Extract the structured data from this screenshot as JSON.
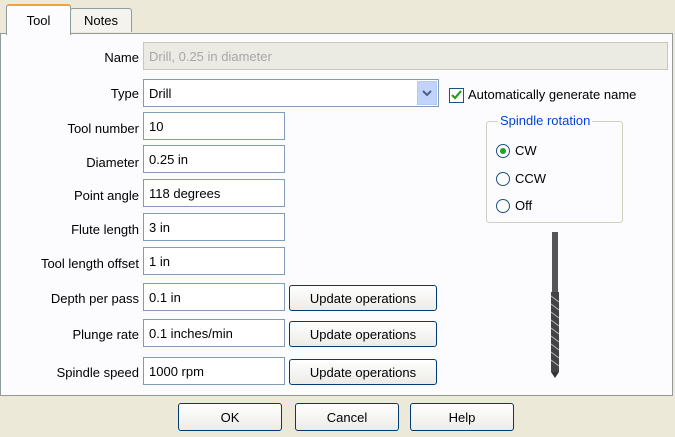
{
  "tabs": [
    {
      "label": "Tool"
    },
    {
      "label": "Notes"
    }
  ],
  "form": {
    "name": {
      "label": "Name",
      "value": "Drill, 0.25 in diameter"
    },
    "type": {
      "label": "Type",
      "value": "Drill"
    },
    "auto_name": {
      "label": "Automatically generate name",
      "checked": true
    },
    "tool_number": {
      "label": "Tool number",
      "value": "10"
    },
    "diameter": {
      "label": "Diameter",
      "value": "0.25 in"
    },
    "point_angle": {
      "label": "Point angle",
      "value": "118 degrees"
    },
    "flute_length": {
      "label": "Flute length",
      "value": "3 in"
    },
    "tool_length_offset": {
      "label": "Tool length offset",
      "value": "1 in"
    },
    "depth_per_pass": {
      "label": "Depth per pass",
      "value": "0.1 in",
      "button": "Update operations"
    },
    "plunge_rate": {
      "label": "Plunge rate",
      "value": "0.1 inches/min",
      "button": "Update operations"
    },
    "spindle_speed": {
      "label": "Spindle speed",
      "value": "1000 rpm",
      "button": "Update operations"
    }
  },
  "spindle_rotation": {
    "title": "Spindle rotation",
    "options": [
      {
        "label": "CW",
        "selected": true
      },
      {
        "label": "CCW",
        "selected": false
      },
      {
        "label": "Off",
        "selected": false
      }
    ]
  },
  "footer": {
    "ok": "OK",
    "cancel": "Cancel",
    "help": "Help"
  },
  "colors": {
    "tab_accent": "#f1a33b",
    "group_title": "#0046d5",
    "check_mark": "#21a121"
  }
}
